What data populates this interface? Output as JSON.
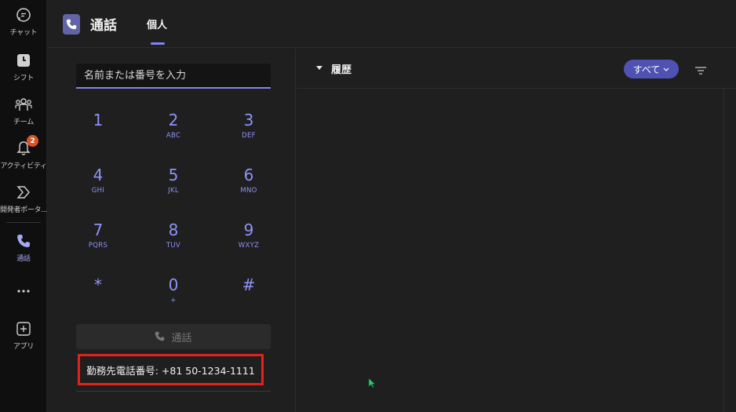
{
  "rail": {
    "items": [
      {
        "label": "チャット",
        "icon": "chat-icon"
      },
      {
        "label": "シフト",
        "icon": "shifts-icon"
      },
      {
        "label": "チーム",
        "icon": "teams-icon"
      },
      {
        "label": "アクティビティ",
        "icon": "bell-icon",
        "badge": "2"
      },
      {
        "label": "開発者ポータ...",
        "icon": "developer-portal-icon"
      },
      {
        "label": "通話",
        "icon": "phone-icon"
      },
      {
        "label": "",
        "icon": "more-icon"
      },
      {
        "label": "アプリ",
        "icon": "apps-icon"
      }
    ]
  },
  "header": {
    "title": "通話",
    "tab": "個人"
  },
  "dialer": {
    "search_placeholder": "名前または番号を入力",
    "keys": [
      {
        "digit": "1",
        "sub": ""
      },
      {
        "digit": "2",
        "sub": "ABC"
      },
      {
        "digit": "3",
        "sub": "DEF"
      },
      {
        "digit": "4",
        "sub": "GHI"
      },
      {
        "digit": "5",
        "sub": "JKL"
      },
      {
        "digit": "6",
        "sub": "MNO"
      },
      {
        "digit": "7",
        "sub": "PQRS"
      },
      {
        "digit": "8",
        "sub": "TUV"
      },
      {
        "digit": "9",
        "sub": "WXYZ"
      },
      {
        "digit": "*",
        "sub": ""
      },
      {
        "digit": "0",
        "sub": "+"
      },
      {
        "digit": "#",
        "sub": ""
      }
    ],
    "call_label": "通話",
    "work_number": "勤務先電話番号: +81 50-1234-1111"
  },
  "history": {
    "title": "履歴",
    "filter_label": "すべて"
  },
  "colors": {
    "accent": "#7f85f5",
    "pill": "#4f52b2",
    "highlight_border": "#e5201d"
  }
}
